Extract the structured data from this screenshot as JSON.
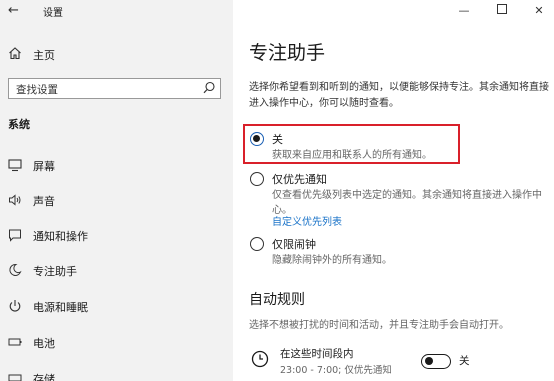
{
  "app": {
    "title": "设置"
  },
  "sidebar": {
    "home": "主页",
    "search_placeholder": "查找设置",
    "section": "系统",
    "items": [
      {
        "label": "屏幕",
        "icon": "monitor-icon"
      },
      {
        "label": "声音",
        "icon": "speaker-icon"
      },
      {
        "label": "通知和操作",
        "icon": "notification-icon"
      },
      {
        "label": "专注助手",
        "icon": "moon-icon"
      },
      {
        "label": "电源和睡眠",
        "icon": "power-icon"
      },
      {
        "label": "电池",
        "icon": "battery-icon"
      },
      {
        "label": "存储",
        "icon": "storage-icon"
      }
    ]
  },
  "main": {
    "title": "专注助手",
    "description": "选择你希望看到和听到的通知，以便能够保持专注。其余通知将直接进入操作中心，你可以随时查看。",
    "options": [
      {
        "label": "关",
        "sub": "获取来自应用和联系人的所有通知。",
        "checked": true
      },
      {
        "label": "仅优先通知",
        "sub": "仅查看优先级列表中选定的通知。其余通知将直接进入操作中心。",
        "link": "自定义优先列表",
        "checked": false
      },
      {
        "label": "仅限闹钟",
        "sub": "隐藏除闹钟外的所有通知。",
        "checked": false
      }
    ],
    "auto_rules": {
      "title": "自动规则",
      "description": "选择不想被打扰的时间和活动，并且专注助手会自动打开。",
      "rule": {
        "label": "在这些时间段内",
        "sub": "23:00 - 7:00; 仅优先通知",
        "toggle_label": "关",
        "toggle_on": false
      }
    }
  },
  "colors": {
    "highlight": "#d9202a",
    "link": "#1a73c8",
    "sidebar_bg": "#f2f2f2"
  }
}
